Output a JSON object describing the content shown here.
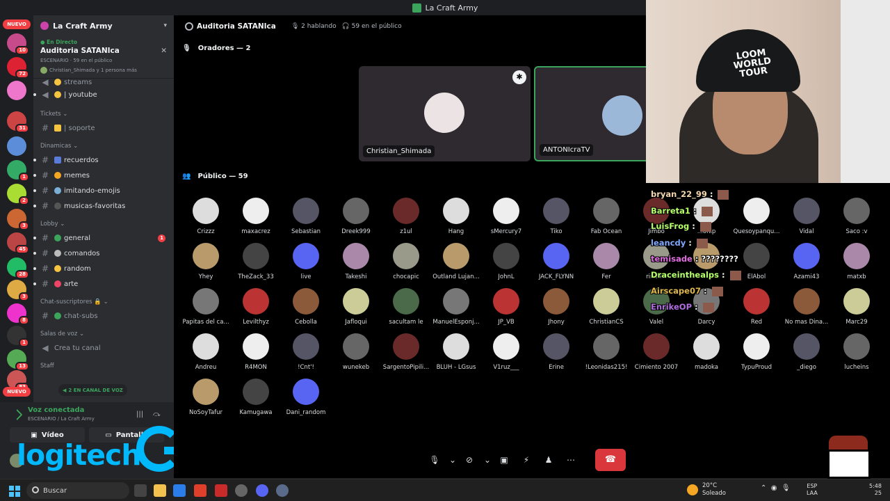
{
  "window": {
    "title": "La Craft Army"
  },
  "rail": {
    "new_label_top": "NUEVO",
    "new_label_bottom": "NUEVO",
    "badges": [
      "10",
      "72",
      "31",
      "1",
      "2",
      "3",
      "45",
      "28",
      "3",
      "8",
      "1",
      "13",
      "83"
    ]
  },
  "sidebar": {
    "server_name": "La Craft Army",
    "live": {
      "tag": "En Directo",
      "title": "Auditoria SATANIca",
      "meta": "ESCENARIO · 59 en el público",
      "speakers": "Christian_Shimada y 1 persona más"
    },
    "channels_top": [
      {
        "name": "streams"
      },
      {
        "name": "| youtube"
      }
    ],
    "cat_tickets": "Tickets",
    "ch_soporte": "| soporte",
    "cat_dinamicas": "Dinamicas",
    "dinamicas": [
      "recuerdos",
      "memes",
      "imitando-emojis",
      "musicas-favoritas"
    ],
    "cat_lobby": "Lobby",
    "lobby": [
      "general",
      "comandos",
      "random",
      "arte"
    ],
    "lobby_badge": "1",
    "cat_subs": "Chat-suscriptores",
    "ch_subs": "chat-subs",
    "cat_voice": "Salas de voz",
    "ch_create": "Crea tu canal",
    "cat_staff": "Staff",
    "voice_pill": "2 EN CANAL DE VOZ"
  },
  "voice_panel": {
    "status": "Voz conectada",
    "location": "ESCENARIO / La Craft Army",
    "video_label": "Vídeo",
    "screen_label": "Pantalla",
    "user_label": "AN"
  },
  "main": {
    "channel_name": "Auditoria SATANIca",
    "speaking": "2 hablando",
    "audience_count": "59 en el público",
    "speakers_header": "Oradores — 2",
    "audience_header": "Público — 59",
    "speakers": [
      {
        "name": "Christian_Shimada",
        "color": "#e6e0e0"
      },
      {
        "name": "ANTONIcraTV",
        "color": "#9cb8d8"
      }
    ],
    "audience_rows": [
      [
        "Crizzz",
        "maxacrez",
        "Sebastian",
        "Dreek999",
        "z1ul",
        "Hang",
        "sMercury7",
        "Tiko",
        "Fab Ocean",
        "Jimbo",
        "...onlp",
        "Quesoypanqu...",
        "Vidal",
        "Saco :v"
      ],
      [
        "Yhey",
        "TheZack_33",
        "live",
        "Takeshi",
        "chocapic",
        "Outland Lujan...",
        "JohnL",
        "JACK_FLYNN",
        "Fer",
        "rindo...",
        "",
        "ElÁbol",
        "Azami43",
        "matxb"
      ],
      [
        "Papitas del ca...",
        "Levilthyz",
        "Cebolla",
        "Jafloqui",
        "sacultam le",
        "ManuelEsponj...",
        "JP_VB",
        "Jhony",
        "ChristianCS",
        "Valel",
        "Darcy",
        "Red",
        "No mas Dina...",
        "Marc29"
      ],
      [
        "Andreu",
        "R4MON",
        "!Cnt'!",
        "wunekeb",
        "SargentoPipili...",
        "BLUH - LGsus",
        "V1ruz___",
        "Erine",
        "!Leonidas215!",
        "Cimiento 2007",
        "madoka",
        "TypuProud",
        "_diego",
        "lucheins"
      ],
      [
        "NoSoyTafur",
        "Kamugawa",
        "Dani_random"
      ]
    ]
  },
  "chat_overlay": [
    {
      "user": "bryan_22_99",
      "msg": "",
      "color": "#f5d7b0"
    },
    {
      "user": "Barreta1",
      "msg": "",
      "color": "#b6ff6b"
    },
    {
      "user": "LuisFrog",
      "msg": "",
      "color": "#b6ff6b"
    },
    {
      "user": "leancdy",
      "msg": "",
      "color": "#7fa8ff"
    },
    {
      "user": "temisade",
      "msg": "????????",
      "color": "#e06ee0"
    },
    {
      "user": "Draceinthealps",
      "msg": "",
      "color": "#b6ff6b"
    },
    {
      "user": "Airscape07",
      "msg": "",
      "color": "#e0b84a"
    },
    {
      "user": "EnrikeOP",
      "msg": "",
      "color": "#b06ee0"
    }
  ],
  "webcam": {
    "cap_text": "LOOM WORLD TOUR"
  },
  "taskbar": {
    "search_label": "Buscar",
    "weather_temp": "20°C",
    "weather_desc": "Soleado",
    "lang_top": "ESP",
    "lang_bottom": "LAA",
    "time": "5:48",
    "date": "25"
  }
}
